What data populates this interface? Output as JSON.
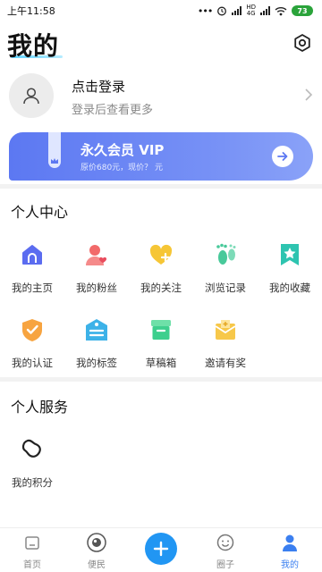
{
  "status_bar": {
    "time": "上午11:58",
    "battery": "73",
    "network": "4G"
  },
  "header": {
    "title": "我的"
  },
  "login": {
    "title": "点击登录",
    "subtitle": "登录后查看更多"
  },
  "vip": {
    "title": "永久会员 VIP",
    "subtitle": "原价680元，现价？ 元"
  },
  "personal_center": {
    "title": "个人中心",
    "items": [
      {
        "label": "我的主页",
        "icon": "home-icon",
        "color": "#5b6cf0"
      },
      {
        "label": "我的粉丝",
        "icon": "fans-icon",
        "color": "#f26a6a"
      },
      {
        "label": "我的关注",
        "icon": "heart-plus-icon",
        "color": "#f6c636"
      },
      {
        "label": "浏览记录",
        "icon": "footprint-icon",
        "color": "#48c99a"
      },
      {
        "label": "我的收藏",
        "icon": "star-bookmark-icon",
        "color": "#2ec4b0"
      },
      {
        "label": "我的认证",
        "icon": "shield-check-icon",
        "color": "#f7a440"
      },
      {
        "label": "我的标签",
        "icon": "tag-icon",
        "color": "#3db2e8"
      },
      {
        "label": "草稿箱",
        "icon": "drafts-box-icon",
        "color": "#3ecf8e"
      },
      {
        "label": "邀请有奖",
        "icon": "invite-envelope-icon",
        "color": "#f7c84a"
      }
    ]
  },
  "personal_service": {
    "title": "个人服务",
    "items": [
      {
        "label": "我的积分",
        "icon": "points-bean-icon"
      }
    ]
  },
  "bottom_nav": {
    "items": [
      {
        "label": "首页",
        "icon": "home-outline-icon"
      },
      {
        "label": "便民",
        "icon": "convenience-icon"
      },
      {
        "label": "圈子",
        "icon": "circle-smile-icon"
      },
      {
        "label": "我的",
        "icon": "user-icon",
        "active": true
      }
    ],
    "active_color": "#3b7ff0"
  }
}
